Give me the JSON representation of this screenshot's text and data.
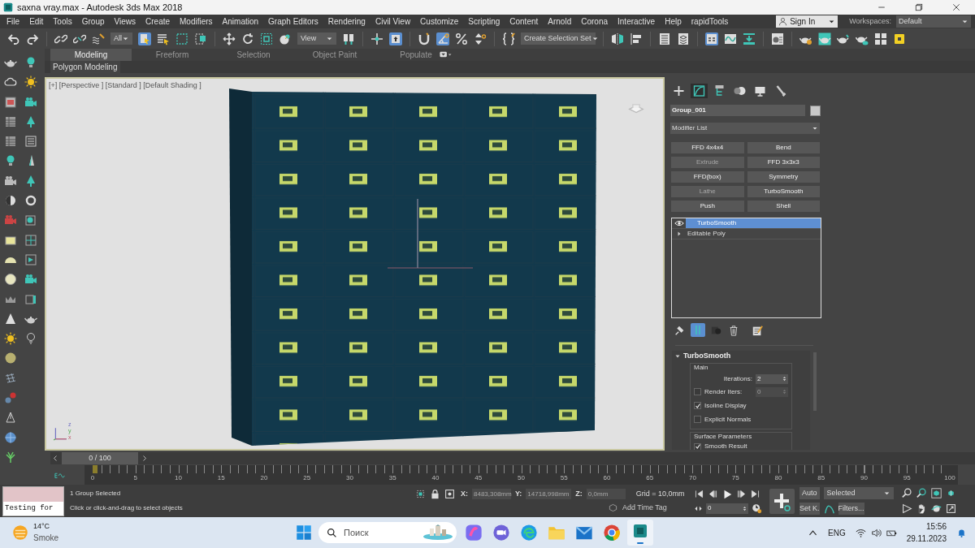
{
  "window": {
    "title": "saxna vray.max - Autodesk 3ds Max 2018"
  },
  "menu": [
    "File",
    "Edit",
    "Tools",
    "Group",
    "Views",
    "Create",
    "Modifiers",
    "Animation",
    "Graph Editors",
    "Rendering",
    "Civil View",
    "Customize",
    "Scripting",
    "Content",
    "Arnold",
    "Corona",
    "Interactive",
    "Help",
    "rapidTools"
  ],
  "sign_in": {
    "label": "Sign In"
  },
  "workspaces": {
    "label": "Workspaces:",
    "value": "Default"
  },
  "toolbar": {
    "selection_filter": "All",
    "reference_coordinate": "View",
    "selection_set": "Create Selection Set"
  },
  "ribbon": {
    "tabs": [
      {
        "label": "Modeling",
        "selected": true
      },
      {
        "label": "Freeform",
        "selected": false
      },
      {
        "label": "Selection",
        "selected": false
      },
      {
        "label": "Object Paint",
        "selected": false
      },
      {
        "label": "Populate",
        "selected": false
      }
    ],
    "panel": "Polygon Modeling"
  },
  "viewport": {
    "label": "[+] [Perspective ] [Standard ] [Default Shading ]",
    "axes": [
      "z",
      "y",
      "x"
    ]
  },
  "command_panel": {
    "tabs": [
      {
        "kind": "create",
        "selected": false
      },
      {
        "kind": "modify",
        "selected": true
      },
      {
        "kind": "hierarchy",
        "selected": false
      },
      {
        "kind": "motion",
        "selected": false
      },
      {
        "kind": "display",
        "selected": false
      },
      {
        "kind": "utilities",
        "selected": false
      }
    ],
    "object_name": "Group_001",
    "modifier_list": "Modifier List",
    "modifier_buttons": [
      {
        "label": "FFD 4x4x4",
        "disabled": false
      },
      {
        "label": "Bend",
        "disabled": false
      },
      {
        "label": "Extrude",
        "disabled": true
      },
      {
        "label": "FFD 3x3x3",
        "disabled": false
      },
      {
        "label": "FFD(box)",
        "disabled": false
      },
      {
        "label": "Symmetry",
        "disabled": false
      },
      {
        "label": "Lathe",
        "disabled": true
      },
      {
        "label": "TurboSmooth",
        "disabled": false
      },
      {
        "label": "Push",
        "disabled": false
      },
      {
        "label": "Shell",
        "disabled": false
      }
    ],
    "stack": [
      {
        "label": "TurboSmooth",
        "selected": true,
        "kind": "modifier"
      },
      {
        "label": "Editable Poly",
        "selected": false,
        "kind": "object"
      }
    ],
    "rollout": {
      "title": "TurboSmooth",
      "expanded": true,
      "main_group": "Main",
      "iterations": {
        "label": "Iterations:",
        "value": "2"
      },
      "render_iters": {
        "label": "Render Iters:",
        "checked": false,
        "value": "0"
      },
      "options": [
        {
          "label": "Isoline Display",
          "checked": true
        },
        {
          "label": "Explicit Normals",
          "checked": false
        }
      ],
      "surface_group": "Surface Parameters",
      "smooth_result": {
        "label": "Smooth Result",
        "checked": true
      }
    }
  },
  "timeline": {
    "frame": "0 / 100",
    "level": 0,
    "ticks": [
      "0",
      "5",
      "10",
      "15",
      "20",
      "25",
      "30",
      "35",
      "40",
      "45",
      "50",
      "55",
      "60",
      "65",
      "70",
      "75",
      "80",
      "85",
      "90",
      "95",
      "100"
    ]
  },
  "status": {
    "listener": "Testing for",
    "selection": "1 Group Selected",
    "prompt": "Click or click-and-drag to select objects",
    "coords": [
      {
        "label": "X:",
        "value": "8483,308mm"
      },
      {
        "label": "Y:",
        "value": "14718,998mm"
      },
      {
        "label": "Z:",
        "value": "0,0mm"
      }
    ],
    "grid": "Grid = 10,0mm",
    "time_tag": "Add Time Tag",
    "current_frame": "0",
    "auto_key": "Auto",
    "set_key": "Set K.",
    "key_filter": "Selected",
    "filters": "Filters..."
  },
  "taskbar": {
    "temperature": "14°C",
    "weather": "Smoke",
    "search": "Поиск",
    "language": "ENG",
    "time": "15:56",
    "date": "29.11.2023"
  }
}
